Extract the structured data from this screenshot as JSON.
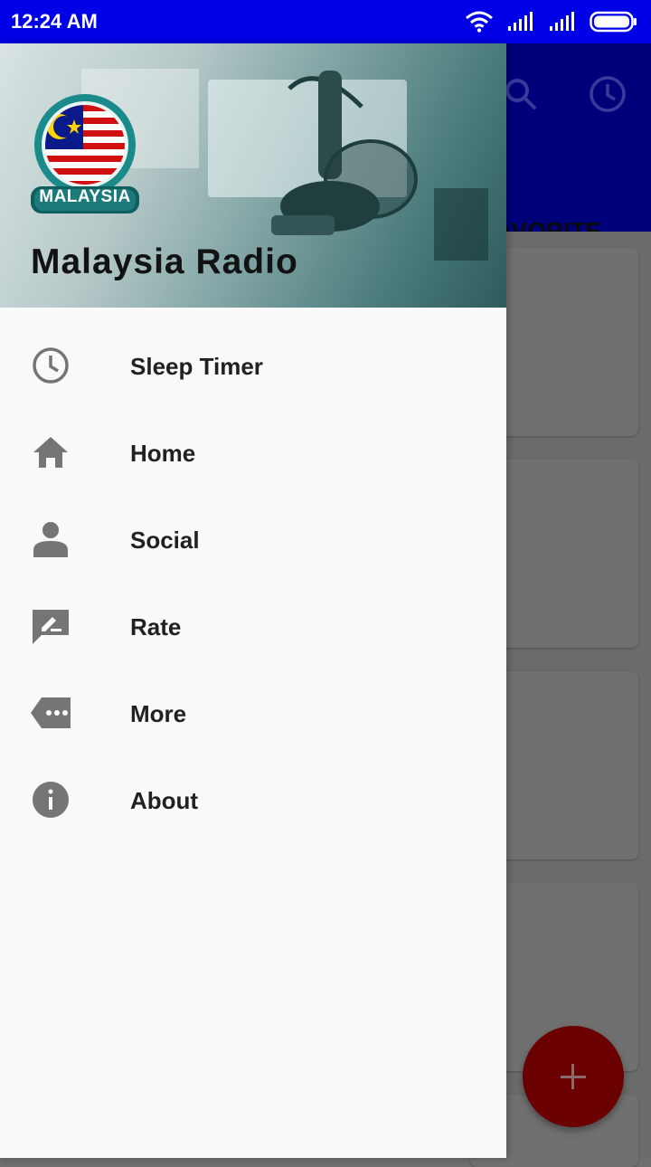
{
  "status_bar": {
    "time": "12:24 AM"
  },
  "app_bar": {
    "visible_tab": "AVORITE"
  },
  "drawer": {
    "badge_text": "MALAYSIA",
    "title": "Malaysia Radio",
    "items": [
      {
        "label": "Sleep Timer",
        "icon": "clock-icon"
      },
      {
        "label": "Home",
        "icon": "home-icon"
      },
      {
        "label": "Social",
        "icon": "person-icon"
      },
      {
        "label": "Rate",
        "icon": "rate-icon"
      },
      {
        "label": "More",
        "icon": "more-icon"
      },
      {
        "label": "About",
        "icon": "info-icon"
      }
    ]
  },
  "colors": {
    "status_bar": "#0000e6",
    "app_bar_dimmed": "#00007a",
    "fab_dimmed": "#6a0000",
    "drawer_bg": "#fafafa",
    "icon_gray": "#757575"
  }
}
